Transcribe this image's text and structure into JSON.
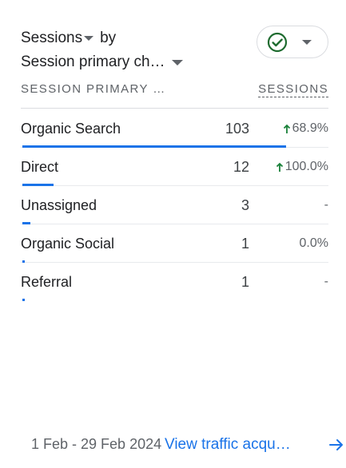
{
  "card": {
    "title_part1": "Sessions",
    "title_by": "by",
    "title_dimension": "Session primary ch…"
  },
  "table": {
    "header_dimension": "SESSION PRIMARY …",
    "header_metric": "SESSIONS",
    "rows": [
      {
        "label": "Organic Search",
        "value": "103",
        "change": "68.9%",
        "trend": "up",
        "share": 1.0
      },
      {
        "label": "Direct",
        "value": "12",
        "change": "100.0%",
        "trend": "up",
        "share": 0.117
      },
      {
        "label": "Unassigned",
        "value": "3",
        "change": "-",
        "trend": "none",
        "share": 0.029
      },
      {
        "label": "Organic Social",
        "value": "1",
        "change": "0.0%",
        "trend": "none",
        "share": 0.01
      },
      {
        "label": "Referral",
        "value": "1",
        "change": "-",
        "trend": "none",
        "share": 0.01
      }
    ]
  },
  "footer": {
    "date_range": "1 Feb - 29 Feb 2024",
    "link_text": "View traffic acqu…"
  },
  "colors": {
    "accent": "#1a73e8",
    "status_green": "#1e6b2f",
    "trend_up": "#188038"
  },
  "icons": {
    "status": "check-circle-icon",
    "trend_up": "arrow-up-icon",
    "footer": "arrow-right-icon"
  }
}
